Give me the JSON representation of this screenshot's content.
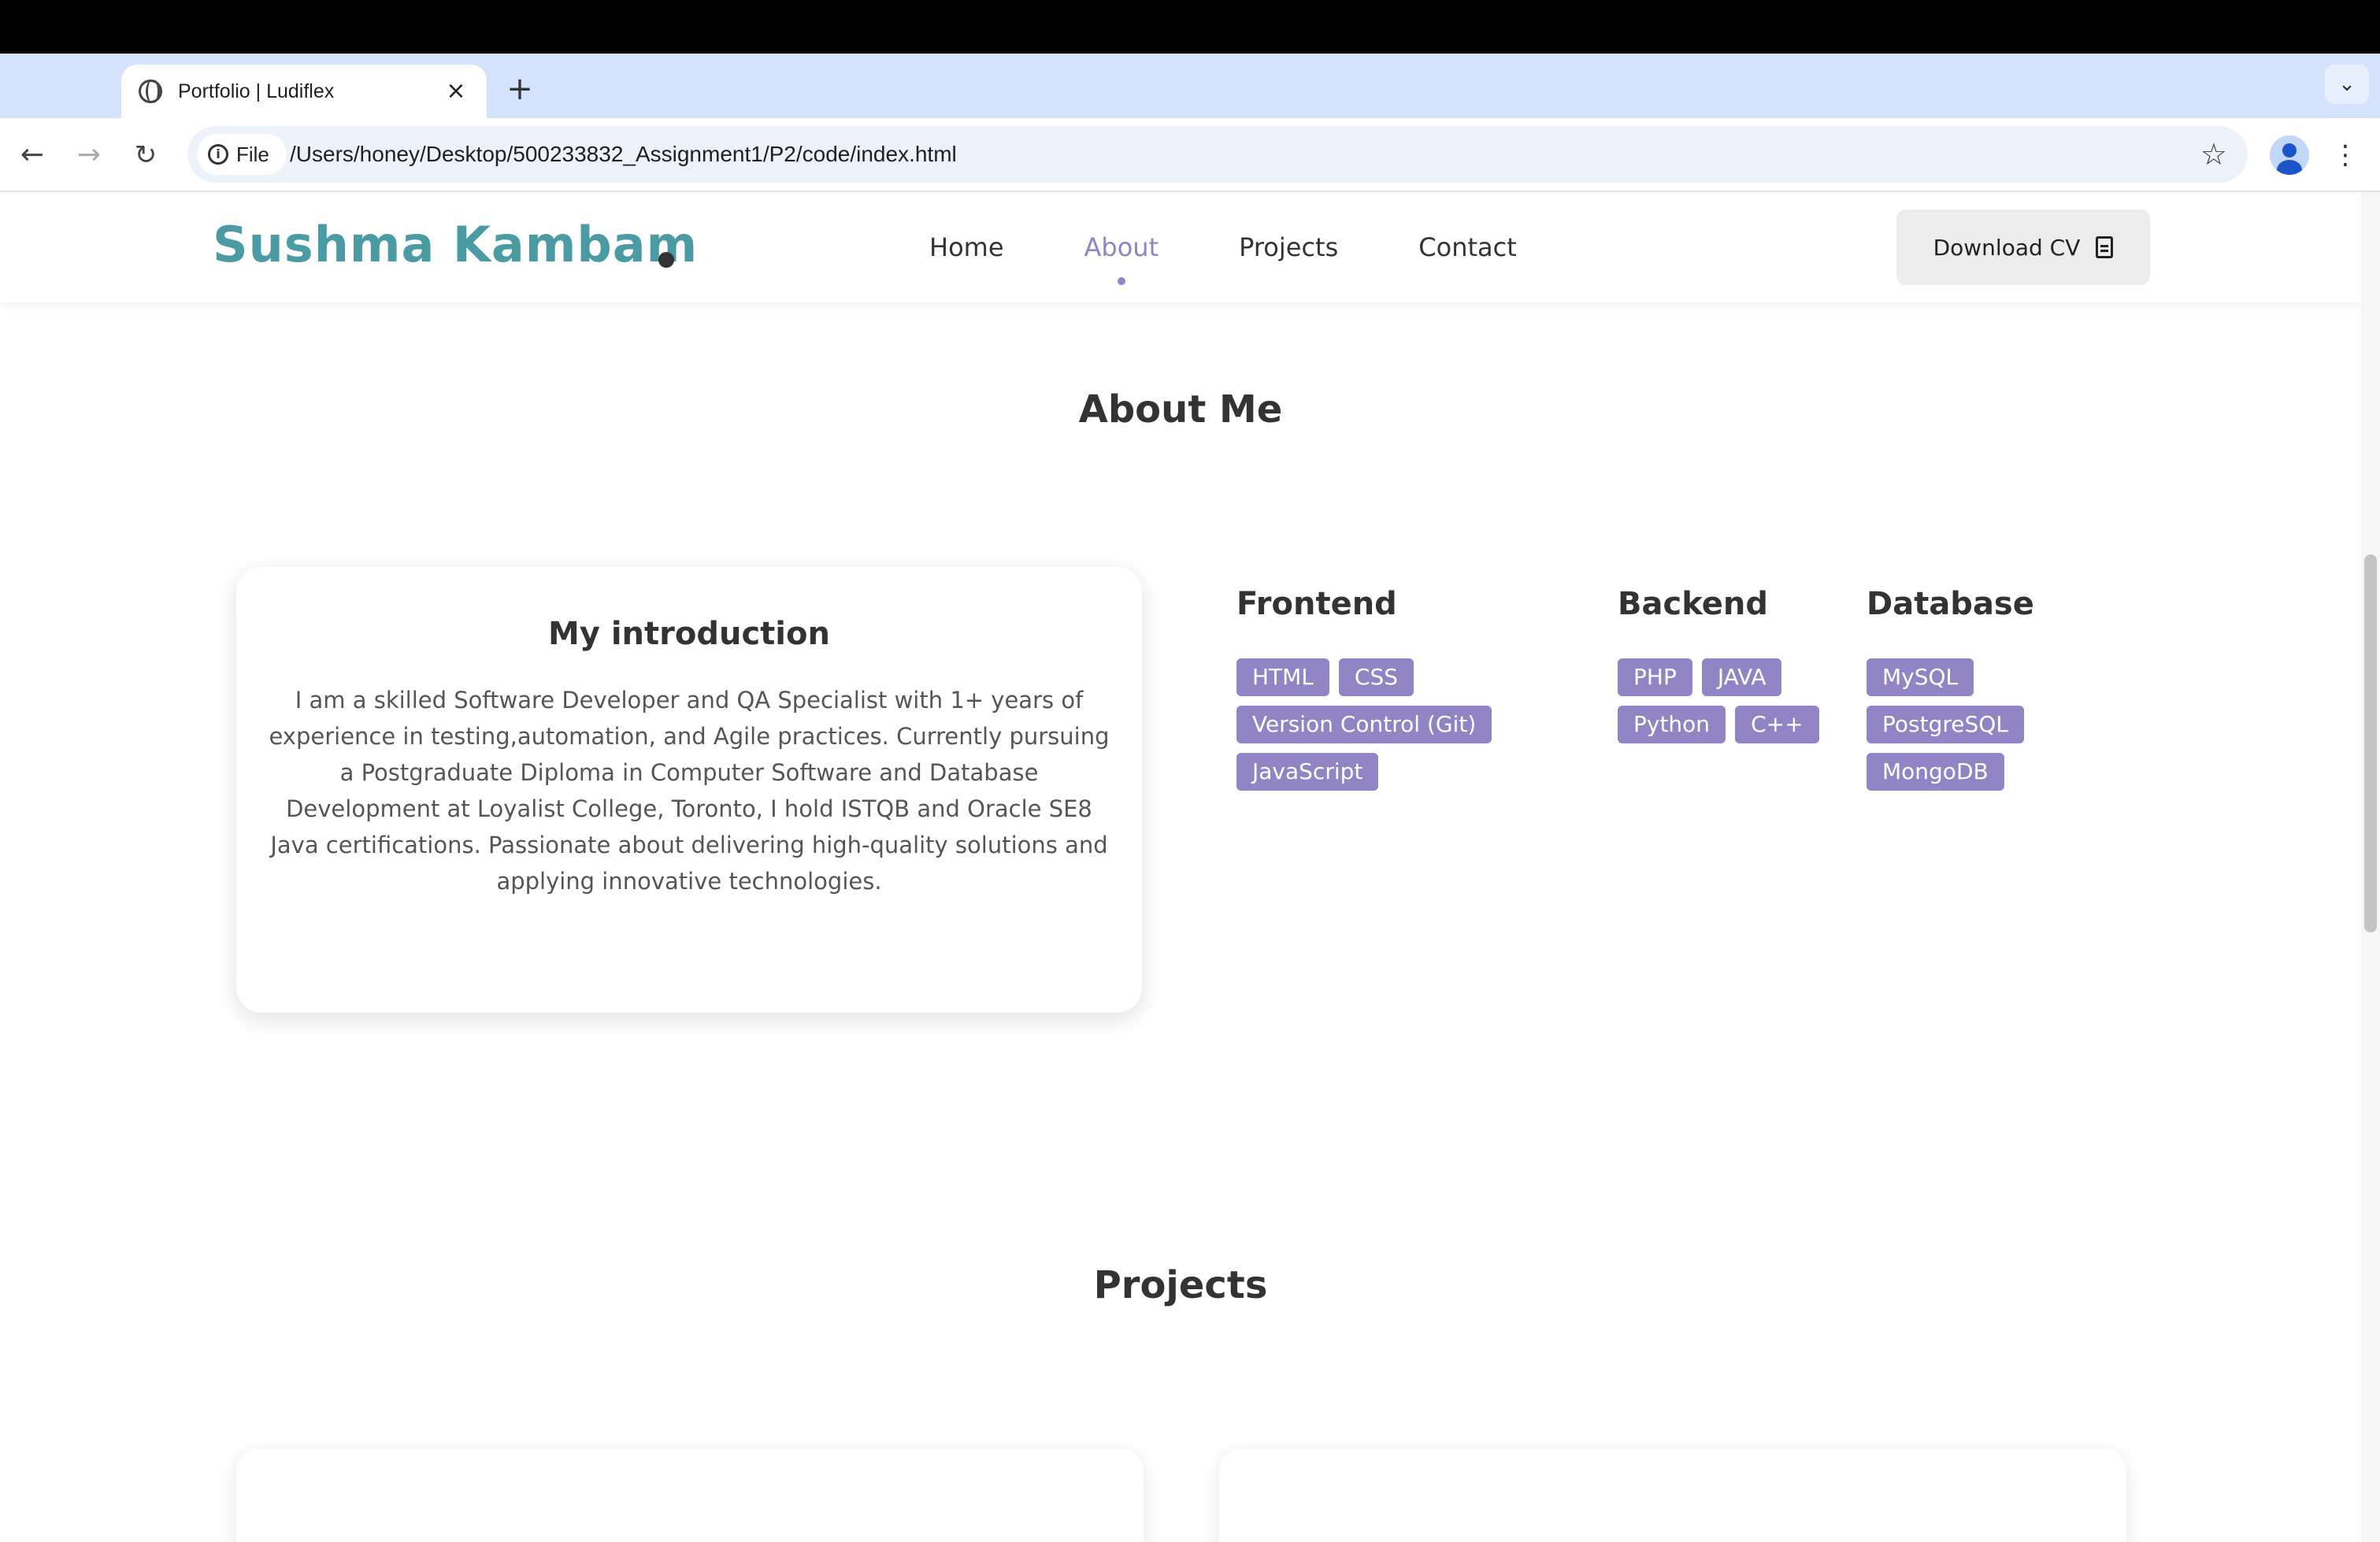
{
  "browser": {
    "tab_title": "Portfolio | Ludiflex",
    "tab_close": "×",
    "new_tab": "+",
    "tab_search": "⌄",
    "scheme_chip": "File",
    "url": "/Users/honey/Desktop/500233832_Assignment1/P2/code/index.html",
    "back": "←",
    "forward": "→",
    "reload": "↻",
    "bookmark": "☆",
    "menu": "⋮"
  },
  "site": {
    "logo": "Sushma Kambam",
    "nav": [
      {
        "label": "Home",
        "active": false
      },
      {
        "label": "About",
        "active": true
      },
      {
        "label": "Projects",
        "active": false
      },
      {
        "label": "Contact",
        "active": false
      }
    ],
    "download_cv": "Download CV",
    "accent_color": "#9184c4",
    "logo_color": "#4a9ba3"
  },
  "about": {
    "title": "About Me",
    "intro_heading": "My introduction",
    "intro_text": "I am a skilled Software Developer and QA Specialist with 1+ years of experience in testing,automation, and Agile practices. Currently pursuing a Postgraduate Diploma in Computer Software and Database Development at Loyalist College, Toronto, I hold ISTQB and Oracle SE8 Java certifications. Passionate about delivering high-quality solutions and applying innovative technologies.",
    "skills": {
      "frontend": {
        "heading": "Frontend",
        "items": [
          "HTML",
          "CSS",
          "Version Control (Git)",
          "JavaScript"
        ]
      },
      "backend": {
        "heading": "Backend",
        "items": [
          "PHP",
          "JAVA",
          "Python",
          "C++"
        ]
      },
      "database": {
        "heading": "Database",
        "items": [
          "MySQL",
          "PostgreSQL",
          "MongoDB"
        ]
      }
    }
  },
  "projects": {
    "title": "Projects"
  }
}
